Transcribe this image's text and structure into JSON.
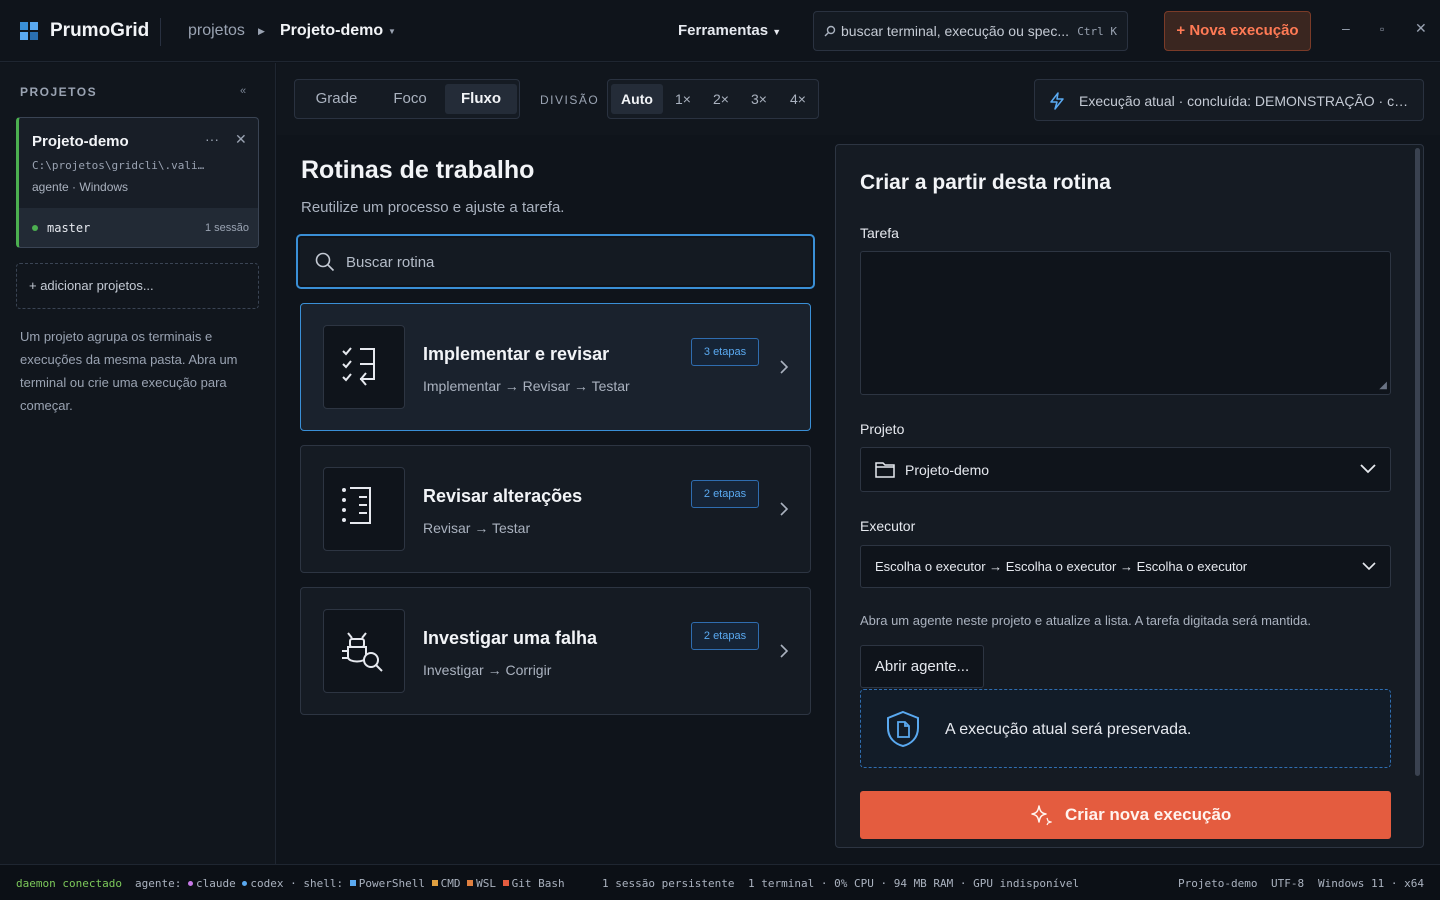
{
  "app": {
    "name": "PrumoGrid"
  },
  "breadcrumb": {
    "root": "projetos",
    "current": "Projeto-demo"
  },
  "header": {
    "tools_label": "Ferramentas",
    "search_placeholder": "buscar terminal, execução ou spec...",
    "search_shortcut": "Ctrl K",
    "new_exec_label": "+ Nova execução",
    "window_controls": [
      "–",
      "▫",
      "✕"
    ]
  },
  "sidebar": {
    "title": "PROJETOS",
    "collapse_glyph": "«",
    "project": {
      "name": "Projeto-demo",
      "path": "C:\\projetos\\gridcli\\.vali…",
      "meta": "agente · Windows",
      "branch": "master",
      "sessions": "1 sessão"
    },
    "add_label": "+ adicionar projetos...",
    "help": "Um projeto agrupa os terminais e execuções da mesma pasta. Abra um terminal ou crie uma execução para começar."
  },
  "toolbar": {
    "views": [
      "Grade",
      "Foco",
      "Fluxo"
    ],
    "active_view": "Fluxo",
    "division_label": "DIVISÃO",
    "divisions": [
      "Auto",
      "1×",
      "2×",
      "3×",
      "4×"
    ],
    "active_division": "Auto",
    "exec_status": "Execução atual · concluída: DEMONSTRAÇÃO · con..."
  },
  "routines": {
    "title": "Rotinas de trabalho",
    "subtitle": "Reutilize um processo e ajuste a tarefa.",
    "search_placeholder": "Buscar rotina",
    "items": [
      {
        "title": "Implementar e revisar",
        "steps": "Implementar → Revisar → Testar",
        "badge": "3 etapas",
        "icon": "checklist-icon"
      },
      {
        "title": "Revisar alterações",
        "steps": "Revisar → Testar",
        "badge": "2 etapas",
        "icon": "list-icon"
      },
      {
        "title": "Investigar uma falha",
        "steps": "Investigar → Corrigir",
        "badge": "2 etapas",
        "icon": "bug-search-icon"
      }
    ]
  },
  "create_panel": {
    "title": "Criar a partir desta rotina",
    "task_label": "Tarefa",
    "task_value": "",
    "project_label": "Projeto",
    "project_value": "Projeto-demo",
    "executor_label": "Executor",
    "executor_value": "Escolha o executor → Escolha o executor → Escolha o executor",
    "hint": "Abra um agente neste projeto e atualize a lista. A tarefa digitada será mantida.",
    "open_agent_label": "Abrir agente...",
    "preserve_note": "A execução atual será preservada.",
    "create_label": "Criar nova execução"
  },
  "statusbar": {
    "daemon": "daemon conectado",
    "agents_label": "agente:",
    "agents": [
      "claude",
      "codex"
    ],
    "shell_label": "shell:",
    "shells": [
      "PowerShell",
      "CMD",
      "WSL",
      "Git Bash"
    ],
    "sessions": "1 sessão persistente",
    "resources": "1 terminal · 0% CPU · 94 MB RAM · GPU indisponível",
    "right": [
      "Projeto-demo",
      "UTF-8",
      "Windows 11 · x64"
    ]
  },
  "colors": {
    "accent": "#e45c3f",
    "selection": "#3a8fd6",
    "online": "#4caf50"
  }
}
